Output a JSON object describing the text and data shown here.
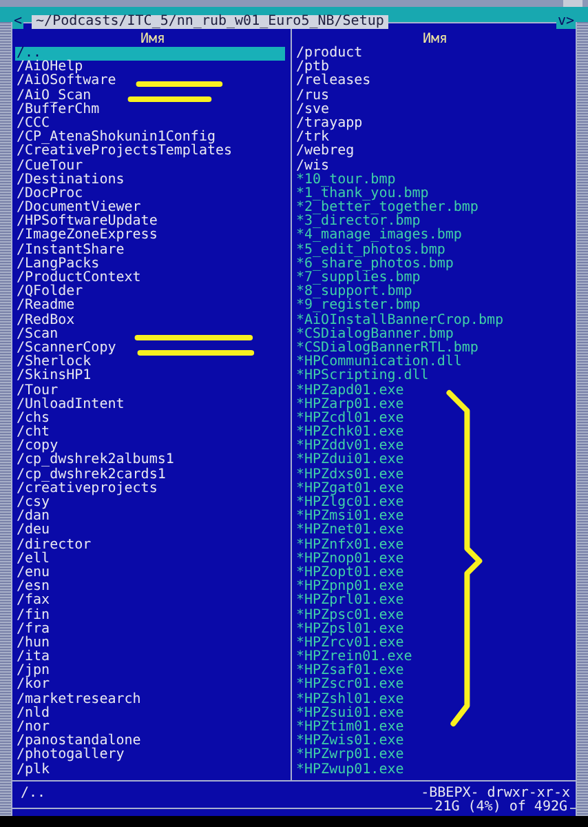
{
  "panel": {
    "left_marker": "<",
    "path": "~/Podcasts/ITC_5/nn_rub_w01_Euro5_NB/Setup",
    "right_marker": "v>",
    "columns": [
      {
        "header": "Имя",
        "items": [
          {
            "name": "/..",
            "kind": "dir",
            "selected": true
          },
          {
            "name": "/AiOHelp",
            "kind": "dir",
            "selected": false
          },
          {
            "name": "/AiOSoftware",
            "kind": "dir",
            "selected": false
          },
          {
            "name": "/AiO_Scan",
            "kind": "dir",
            "selected": false
          },
          {
            "name": "/BufferChm",
            "kind": "dir",
            "selected": false
          },
          {
            "name": "/CCC",
            "kind": "dir",
            "selected": false
          },
          {
            "name": "/CP_AtenaShokunin1Config",
            "kind": "dir",
            "selected": false
          },
          {
            "name": "/CreativeProjectsTemplates",
            "kind": "dir",
            "selected": false
          },
          {
            "name": "/CueTour",
            "kind": "dir",
            "selected": false
          },
          {
            "name": "/Destinations",
            "kind": "dir",
            "selected": false
          },
          {
            "name": "/DocProc",
            "kind": "dir",
            "selected": false
          },
          {
            "name": "/DocumentViewer",
            "kind": "dir",
            "selected": false
          },
          {
            "name": "/HPSoftwareUpdate",
            "kind": "dir",
            "selected": false
          },
          {
            "name": "/ImageZoneExpress",
            "kind": "dir",
            "selected": false
          },
          {
            "name": "/InstantShare",
            "kind": "dir",
            "selected": false
          },
          {
            "name": "/LangPacks",
            "kind": "dir",
            "selected": false
          },
          {
            "name": "/ProductContext",
            "kind": "dir",
            "selected": false
          },
          {
            "name": "/QFolder",
            "kind": "dir",
            "selected": false
          },
          {
            "name": "/Readme",
            "kind": "dir",
            "selected": false
          },
          {
            "name": "/RedBox",
            "kind": "dir",
            "selected": false
          },
          {
            "name": "/Scan",
            "kind": "dir",
            "selected": false
          },
          {
            "name": "/ScannerCopy",
            "kind": "dir",
            "selected": false
          },
          {
            "name": "/Sherlock",
            "kind": "dir",
            "selected": false
          },
          {
            "name": "/SkinsHP1",
            "kind": "dir",
            "selected": false
          },
          {
            "name": "/Tour",
            "kind": "dir",
            "selected": false
          },
          {
            "name": "/UnloadIntent",
            "kind": "dir",
            "selected": false
          },
          {
            "name": "/chs",
            "kind": "dir",
            "selected": false
          },
          {
            "name": "/cht",
            "kind": "dir",
            "selected": false
          },
          {
            "name": "/copy",
            "kind": "dir",
            "selected": false
          },
          {
            "name": "/cp_dwshrek2albums1",
            "kind": "dir",
            "selected": false
          },
          {
            "name": "/cp_dwshrek2cards1",
            "kind": "dir",
            "selected": false
          },
          {
            "name": "/creativeprojects",
            "kind": "dir",
            "selected": false
          },
          {
            "name": "/csy",
            "kind": "dir",
            "selected": false
          },
          {
            "name": "/dan",
            "kind": "dir",
            "selected": false
          },
          {
            "name": "/deu",
            "kind": "dir",
            "selected": false
          },
          {
            "name": "/director",
            "kind": "dir",
            "selected": false
          },
          {
            "name": "/ell",
            "kind": "dir",
            "selected": false
          },
          {
            "name": "/enu",
            "kind": "dir",
            "selected": false
          },
          {
            "name": "/esn",
            "kind": "dir",
            "selected": false
          },
          {
            "name": "/fax",
            "kind": "dir",
            "selected": false
          },
          {
            "name": "/fin",
            "kind": "dir",
            "selected": false
          },
          {
            "name": "/fra",
            "kind": "dir",
            "selected": false
          },
          {
            "name": "/hun",
            "kind": "dir",
            "selected": false
          },
          {
            "name": "/ita",
            "kind": "dir",
            "selected": false
          },
          {
            "name": "/jpn",
            "kind": "dir",
            "selected": false
          },
          {
            "name": "/kor",
            "kind": "dir",
            "selected": false
          },
          {
            "name": "/marketresearch",
            "kind": "dir",
            "selected": false
          },
          {
            "name": "/nld",
            "kind": "dir",
            "selected": false
          },
          {
            "name": "/nor",
            "kind": "dir",
            "selected": false
          },
          {
            "name": "/panostandalone",
            "kind": "dir",
            "selected": false
          },
          {
            "name": "/photogallery",
            "kind": "dir",
            "selected": false
          },
          {
            "name": "/plk",
            "kind": "dir",
            "selected": false
          }
        ]
      },
      {
        "header": "Имя",
        "items": [
          {
            "name": "/product",
            "kind": "dir",
            "selected": false
          },
          {
            "name": "/ptb",
            "kind": "dir",
            "selected": false
          },
          {
            "name": "/releases",
            "kind": "dir",
            "selected": false
          },
          {
            "name": "/rus",
            "kind": "dir",
            "selected": false
          },
          {
            "name": "/sve",
            "kind": "dir",
            "selected": false
          },
          {
            "name": "/trayapp",
            "kind": "dir",
            "selected": false
          },
          {
            "name": "/trk",
            "kind": "dir",
            "selected": false
          },
          {
            "name": "/webreg",
            "kind": "dir",
            "selected": false
          },
          {
            "name": "/wis",
            "kind": "dir",
            "selected": false
          },
          {
            "name": "*10_tour.bmp",
            "kind": "exec",
            "selected": false
          },
          {
            "name": "*1_thank_you.bmp",
            "kind": "exec",
            "selected": false
          },
          {
            "name": "*2_better_together.bmp",
            "kind": "exec",
            "selected": false
          },
          {
            "name": "*3_director.bmp",
            "kind": "exec",
            "selected": false
          },
          {
            "name": "*4_manage_images.bmp",
            "kind": "exec",
            "selected": false
          },
          {
            "name": "*5_edit_photos.bmp",
            "kind": "exec",
            "selected": false
          },
          {
            "name": "*6_share_photos.bmp",
            "kind": "exec",
            "selected": false
          },
          {
            "name": "*7_supplies.bmp",
            "kind": "exec",
            "selected": false
          },
          {
            "name": "*8_support.bmp",
            "kind": "exec",
            "selected": false
          },
          {
            "name": "*9_register.bmp",
            "kind": "exec",
            "selected": false
          },
          {
            "name": "*AiOInstallBannerCrop.bmp",
            "kind": "exec",
            "selected": false
          },
          {
            "name": "*CSDialogBanner.bmp",
            "kind": "exec",
            "selected": false
          },
          {
            "name": "*CSDialogBannerRTL.bmp",
            "kind": "exec",
            "selected": false
          },
          {
            "name": "*HPCommunication.dll",
            "kind": "exec",
            "selected": false
          },
          {
            "name": "*HPScripting.dll",
            "kind": "exec",
            "selected": false
          },
          {
            "name": "*HPZapd01.exe",
            "kind": "exec",
            "selected": false
          },
          {
            "name": "*HPZarp01.exe",
            "kind": "exec",
            "selected": false
          },
          {
            "name": "*HPZcdl01.exe",
            "kind": "exec",
            "selected": false
          },
          {
            "name": "*HPZchk01.exe",
            "kind": "exec",
            "selected": false
          },
          {
            "name": "*HPZddv01.exe",
            "kind": "exec",
            "selected": false
          },
          {
            "name": "*HPZdui01.exe",
            "kind": "exec",
            "selected": false
          },
          {
            "name": "*HPZdxs01.exe",
            "kind": "exec",
            "selected": false
          },
          {
            "name": "*HPZgat01.exe",
            "kind": "exec",
            "selected": false
          },
          {
            "name": "*HPZlgc01.exe",
            "kind": "exec",
            "selected": false
          },
          {
            "name": "*HPZmsi01.exe",
            "kind": "exec",
            "selected": false
          },
          {
            "name": "*HPZnet01.exe",
            "kind": "exec",
            "selected": false
          },
          {
            "name": "*HPZnfx01.exe",
            "kind": "exec",
            "selected": false
          },
          {
            "name": "*HPZnop01.exe",
            "kind": "exec",
            "selected": false
          },
          {
            "name": "*HPZopt01.exe",
            "kind": "exec",
            "selected": false
          },
          {
            "name": "*HPZpnp01.exe",
            "kind": "exec",
            "selected": false
          },
          {
            "name": "*HPZprl01.exe",
            "kind": "exec",
            "selected": false
          },
          {
            "name": "*HPZpsc01.exe",
            "kind": "exec",
            "selected": false
          },
          {
            "name": "*HPZpsl01.exe",
            "kind": "exec",
            "selected": false
          },
          {
            "name": "*HPZrcv01.exe",
            "kind": "exec",
            "selected": false
          },
          {
            "name": "*HPZrein01.exe",
            "kind": "exec",
            "selected": false
          },
          {
            "name": "*HPZsaf01.exe",
            "kind": "exec",
            "selected": false
          },
          {
            "name": "*HPZscr01.exe",
            "kind": "exec",
            "selected": false
          },
          {
            "name": "*HPZshl01.exe",
            "kind": "exec",
            "selected": false
          },
          {
            "name": "*HPZsui01.exe",
            "kind": "exec",
            "selected": false
          },
          {
            "name": "*HPZtim01.exe",
            "kind": "exec",
            "selected": false
          },
          {
            "name": "*HPZwis01.exe",
            "kind": "exec",
            "selected": false
          },
          {
            "name": "*HPZwrp01.exe",
            "kind": "exec",
            "selected": false
          },
          {
            "name": "*HPZwup01.exe",
            "kind": "exec",
            "selected": false
          }
        ]
      }
    ],
    "status": {
      "name": "/..",
      "attributes": "-BBEPX-",
      "permissions": "drwxr-xr-x",
      "free_space": "21G (4%) of 492G"
    }
  }
}
